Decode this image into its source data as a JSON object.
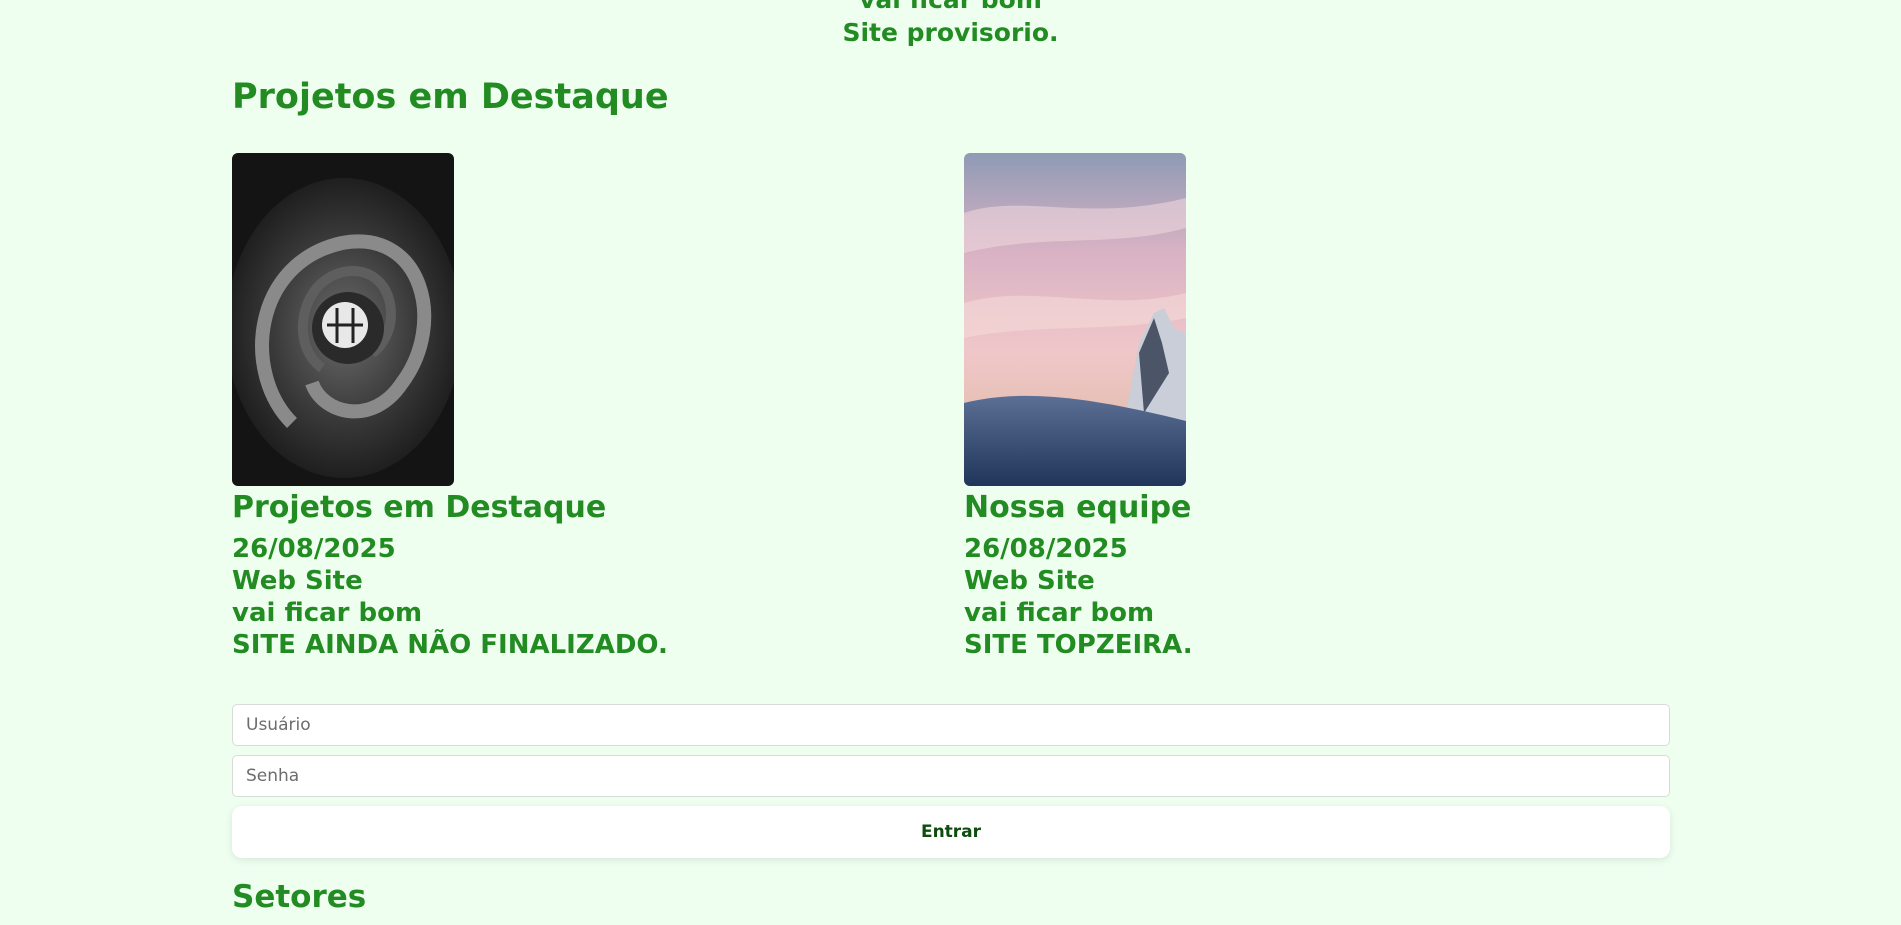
{
  "intro": {
    "line1": "vai ficar bom",
    "line2": "Site provisorio."
  },
  "featured": {
    "title": "Projetos em Destaque",
    "cards": [
      {
        "image": "spiral-staircase-photo",
        "title": "Projetos em Destaque",
        "date": "26/08/2025",
        "category": "Web Site",
        "note": "vai ficar bom",
        "status": "SITE AINDA NÃO FINALIZADO."
      },
      {
        "image": "snowy-mountain-sunset-photo",
        "title": "Nossa equipe",
        "date": "26/08/2025",
        "category": "Web Site",
        "note": "vai ficar bom",
        "status": "SITE TOPZEIRA."
      }
    ]
  },
  "login": {
    "username_placeholder": "Usuário",
    "username_value": "",
    "password_placeholder": "Senha",
    "password_value": "",
    "submit_label": "Entrar"
  },
  "sectors": {
    "title": "Setores"
  },
  "colors": {
    "background": "#eefff0",
    "text": "#228b22",
    "button_text": "#0f4d0f"
  }
}
